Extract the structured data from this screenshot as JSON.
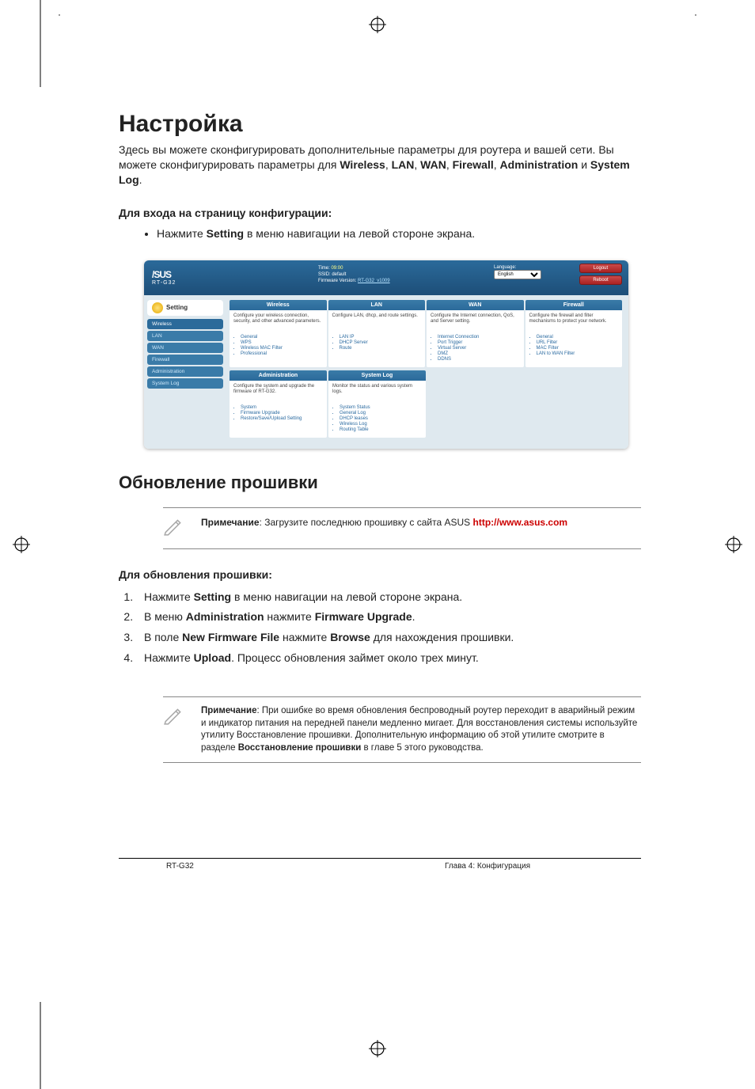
{
  "doc": {
    "title": "Настройка",
    "intro_1a": "Здесь вы можете сконфигурировать дополнительные параметры для роутера и вашей сети. Вы можете сконфигурировать параметры для ",
    "intro_bold": [
      "Wireless",
      "LAN",
      "WAN",
      "Firewall",
      "Administration",
      "System Log"
    ],
    "intro_sep": ", ",
    "intro_and": " и ",
    "intro_end": ".",
    "enter_heading": "Для входа на страницу конфигурации:",
    "enter_step_a": "Нажмите ",
    "enter_step_b": "Setting",
    "enter_step_c": " в меню навигации на левой стороне экрана.",
    "fw_heading": "Обновление прошивки",
    "note1_label": "Примечание",
    "note1_text": ": Загрузите последнюю прошивку с сайта ASUS ",
    "note1_url": "http://www.asus.com",
    "fw_sub": "Для обновления прошивки:",
    "steps": [
      {
        "pre": "Нажмите ",
        "b1": "Setting",
        "post": " в меню навигации на левой стороне экрана."
      },
      {
        "pre": "В меню ",
        "b1": "Administration",
        "mid": "  нажмите ",
        "b2": "Firmware Upgrade",
        "post": "."
      },
      {
        "pre": "В поле ",
        "b1": "New Firmware File",
        "mid": " нажмите ",
        "b2": "Browse",
        "post": " для нахождения  прошивки."
      },
      {
        "pre": "Нажмите ",
        "b1": "Upload",
        "post": ". Процесс обновления займет около трех минут."
      }
    ],
    "note2_label": "Примечание",
    "note2_text_a": ": При ошибке во время обновления беспроводный роутер переходит в аварийный режим и индикатор питания на передней панели медленно мигает. Для восстановления системы используйте утилиту Восстановление прошивки. Дополнительную информацию об этой утилите смотрите в разделе ",
    "note2_bold": "Восстановление прошивки",
    "note2_text_b": " в главе 5 этого руководства.",
    "footer_left": "RT-G32",
    "footer_right": "Глава 4: Конфигурация"
  },
  "router": {
    "logo_top": "/SUS",
    "logo_sub": "RT-G32",
    "time_label": "Time: ",
    "time_val": "09:00",
    "ssid_label": "SSID: ",
    "ssid_val": "default",
    "fw_label": "Firmware Version: ",
    "fw_val": "RT-G32_v1009",
    "lang_label": "Language:",
    "lang_val": "English",
    "btn_logout": "Logout",
    "btn_reboot": "Reboot",
    "side_header": "Setting",
    "nav": [
      "Wireless",
      "LAN",
      "WAN",
      "Firewall",
      "Administration",
      "System Log"
    ],
    "cards": [
      {
        "h": "Wireless",
        "d": "Configure your wireless connection, security, and other advanced parameters.",
        "items": [
          "General",
          "WPS",
          "Wireless MAC Filter",
          "Professional"
        ]
      },
      {
        "h": "LAN",
        "d": "Configure LAN, dhcp, and route settings.",
        "items": [
          "LAN IP",
          "DHCP Server",
          "Route"
        ]
      },
      {
        "h": "WAN",
        "d": "Configure the Internet connection, QoS, and Server setting.",
        "items": [
          "Internet Connection",
          "Port Trigger",
          "Virtual Server",
          "DMZ",
          "DDNS"
        ]
      },
      {
        "h": "Firewall",
        "d": "Configure the firewall and filter mechanisms to protect your network.",
        "items": [
          "General",
          "URL Filter",
          "MAC Filter",
          "LAN to WAN Filter"
        ]
      }
    ],
    "cards2": [
      {
        "h": "Administration",
        "d": "Configure the system and upgrade the firmware of RT-G32.",
        "items": [
          "System",
          "Firmware Upgrade",
          "Restore/Save/Upload Setting"
        ]
      },
      {
        "h": "System Log",
        "d": "Monitor the status and various system logs.",
        "items": [
          "System Status",
          "General Log",
          "DHCP leases",
          "Wireless Log",
          "Routing Table"
        ]
      }
    ]
  },
  "colorbar": [
    "#000",
    "#fff",
    "#404040",
    "#808080",
    "#00a0a0",
    "#007a3d",
    "#ffe600",
    "#e2007a",
    "#d22",
    "#0066b3"
  ]
}
